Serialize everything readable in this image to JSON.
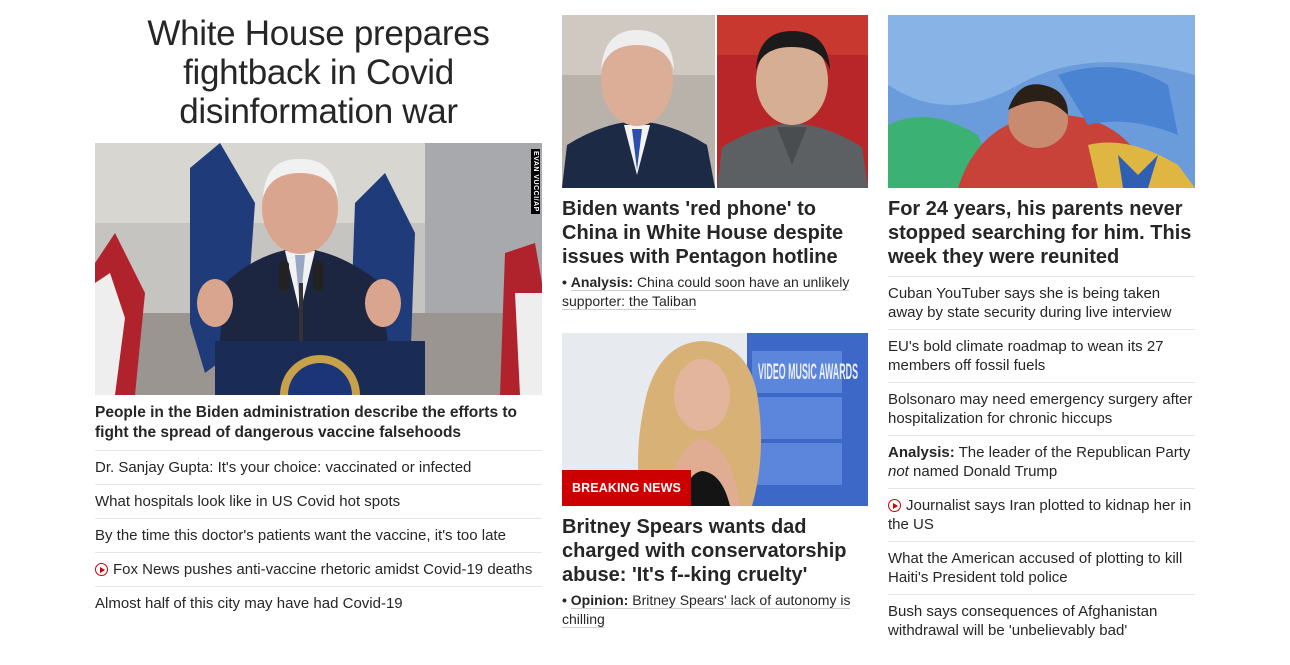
{
  "left": {
    "headline": "White House prepares fightback in Covid disinformation war",
    "photo_credit": "EVAN VUCCI/AP",
    "lead_summary": "People in the Biden administration describe the efforts to fight the spread of dangerous vaccine falsehoods",
    "items": [
      {
        "text": "Dr. Sanjay Gupta: It's your choice: vaccinated or infected",
        "video": false
      },
      {
        "text": "What hospitals look like in US Covid hot spots",
        "video": false
      },
      {
        "text": "By the time this doctor's patients want the vaccine, it's too late",
        "video": false
      },
      {
        "text": "Fox News pushes anti-vaccine rhetoric amidst Covid-19 deaths",
        "video": true
      },
      {
        "text": "Almost half of this city may have had Covid-19",
        "video": false
      }
    ]
  },
  "middle": {
    "card1": {
      "headline": "Biden wants 'red phone' to China in White House despite issues with Pentagon hotline",
      "bullet": "•",
      "kicker": "Analysis:",
      "sub": "China could soon have an unlikely supporter: the Taliban"
    },
    "card2": {
      "badge": "BREAKING NEWS",
      "backdrop_text": "VIDEO MUSIC AWARDS",
      "headline": "Britney Spears wants dad charged with conservatorship abuse: 'It's f--king cruelty'",
      "bullet": "•",
      "kicker": "Opinion:",
      "sub": "Britney Spears' lack of autonomy is chilling"
    }
  },
  "right": {
    "headline": "For 24 years, his parents never stopped searching for him. This week they were reunited",
    "items": [
      {
        "text": "Cuban YouTuber says she is being taken away by state security during live interview"
      },
      {
        "text": "EU's bold climate roadmap to wean its 27 members off fossil fuels"
      },
      {
        "text": "Bolsonaro may need emergency surgery after hospitalization for chronic hiccups"
      },
      {
        "kicker": "Analysis:",
        "text_a": "The leader of the Republican Party",
        "text_em": "not",
        "text_b": "named Donald Trump"
      },
      {
        "text": "Journalist says Iran plotted to kidnap her in the US",
        "video": true
      },
      {
        "text": "What the American accused of plotting to kill Haiti's President told police"
      },
      {
        "text": "Bush says consequences of Afghanistan withdrawal will be 'unbelievably bad'"
      }
    ]
  },
  "colors": {
    "brand_red": "#cc0000",
    "text": "#262626",
    "divider": "#e6e6e6"
  }
}
